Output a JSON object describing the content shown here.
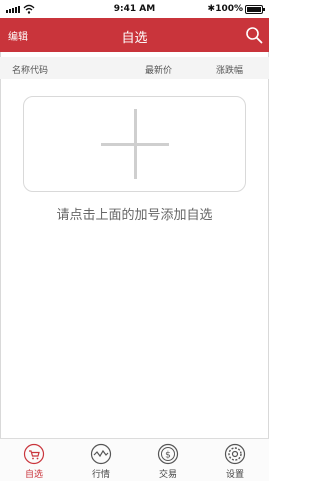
{
  "status_bar": {
    "time": "9:41 AM",
    "battery": "100%",
    "bluetooth": "✱"
  },
  "nav": {
    "edit_label": "编辑",
    "title": "自选",
    "search_icon": "search-icon"
  },
  "columns": {
    "name": "名称代码",
    "price": "最新价",
    "change": "涨跌幅"
  },
  "empty_state": {
    "hint": "请点击上面的加号添加自选"
  },
  "tabs": [
    {
      "label": "自选",
      "icon": "favorites-cart-icon",
      "active": true
    },
    {
      "label": "行情",
      "icon": "market-chart-icon",
      "active": false
    },
    {
      "label": "交易",
      "icon": "trade-dollar-icon",
      "active": false
    },
    {
      "label": "设置",
      "icon": "settings-gear-icon",
      "active": false
    }
  ],
  "colors": {
    "accent": "#c9343b",
    "header_bg": "#f4f4f4",
    "divider": "#d9d9d9"
  }
}
